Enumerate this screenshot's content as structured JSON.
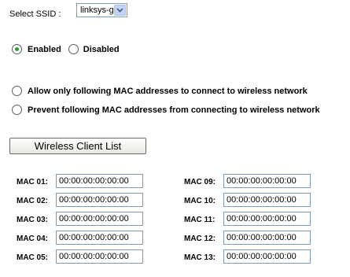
{
  "ssid": {
    "label": "Select SSID :",
    "selected": "linksys-g",
    "arrow_icon": "chevron-down-icon"
  },
  "mode": {
    "enabled_label": "Enabled",
    "disabled_label": "Disabled",
    "selected": "enabled"
  },
  "filter": {
    "allow_label": "Allow only following MAC addresses to connect to wireless network",
    "prevent_label": "Prevent following MAC addresses from connecting to wireless network"
  },
  "client_list_button": "Wireless Client List",
  "mac_left": [
    {
      "label": "MAC 01:",
      "value": "00:00:00:00:00:00"
    },
    {
      "label": "MAC 02:",
      "value": "00:00:00:00:00:00"
    },
    {
      "label": "MAC 03:",
      "value": "00:00:00:00:00:00"
    },
    {
      "label": "MAC 04:",
      "value": "00:00:00:00:00:00"
    },
    {
      "label": "MAC 05:",
      "value": "00:00:00:00:00:00"
    }
  ],
  "mac_right": [
    {
      "label": "MAC 09:",
      "value": "00:00:00:00:00:00"
    },
    {
      "label": "MAC 10:",
      "value": "00:00:00:00:00:00"
    },
    {
      "label": "MAC 11:",
      "value": "00:00:00:00:00:00"
    },
    {
      "label": "MAC 12:",
      "value": "00:00:00:00:00:00"
    },
    {
      "label": "MAC 13:",
      "value": "00:00:00:00:00:00"
    }
  ],
  "colors": {
    "radio_selected": "#21a121",
    "input_border": "#7f9db9",
    "dropdown_arrow_bg": "#c1d3fb"
  }
}
